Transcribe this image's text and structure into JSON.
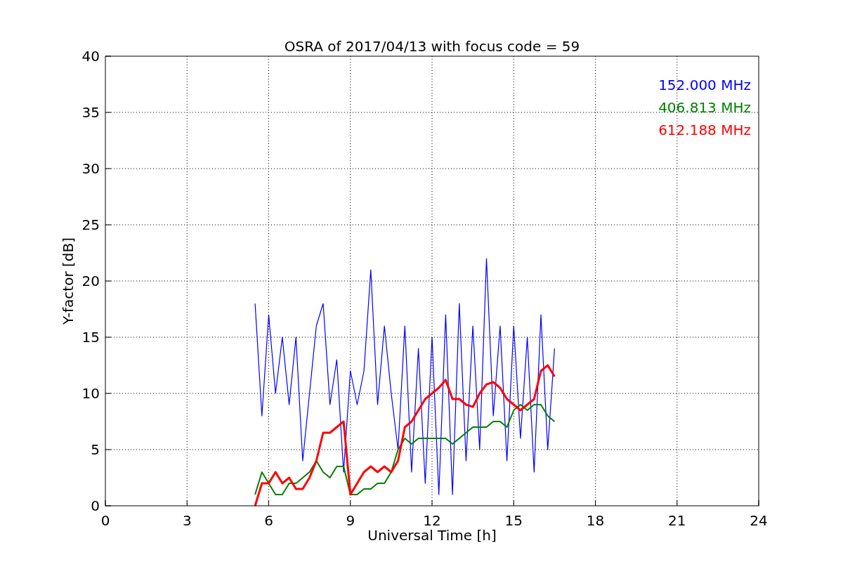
{
  "figure": {
    "chart_data": {
      "type": "line",
      "title": "OSRA of 2017/04/13 with focus code = 59",
      "xlabel": "Universal Time [h]",
      "ylabel": "Y-factor [dB]",
      "x": [
        5.5,
        5.75,
        6,
        6.25,
        6.5,
        6.75,
        7,
        7.25,
        7.5,
        7.75,
        8,
        8.25,
        8.5,
        8.75,
        9,
        9.25,
        9.5,
        9.75,
        10,
        10.25,
        10.5,
        10.75,
        11,
        11.25,
        11.5,
        11.75,
        12,
        12.25,
        12.5,
        12.75,
        13,
        13.25,
        13.5,
        13.75,
        14,
        14.25,
        14.5,
        14.75,
        15,
        15.25,
        15.5,
        15.75,
        16,
        16.25,
        16.5
      ],
      "series": [
        {
          "name": "152.000 MHz",
          "color": "#0000ff",
          "values": [
            18,
            8,
            17,
            10,
            15,
            9,
            15,
            4,
            10,
            16,
            18,
            9,
            13,
            3,
            12,
            9,
            12,
            21,
            9,
            16,
            10,
            5,
            16,
            3,
            14,
            2,
            15,
            1,
            17,
            1,
            18,
            4,
            16,
            5,
            22,
            8,
            16,
            4,
            16,
            6,
            15,
            3,
            17,
            5,
            14
          ]
        },
        {
          "name": "406.813 MHz",
          "color": "#008000",
          "values": [
            1,
            3,
            2,
            1,
            1,
            2,
            2,
            2.5,
            3,
            4,
            3,
            2.5,
            3.5,
            3.5,
            1,
            1,
            1.5,
            1.5,
            2,
            2,
            3,
            5,
            6,
            5.5,
            6,
            6,
            6,
            6,
            6,
            5.5,
            6,
            6.5,
            7,
            7,
            7,
            7.5,
            7.5,
            7,
            8.5,
            9,
            8.5,
            9,
            9,
            8,
            7.5
          ]
        },
        {
          "name": "612.188 MHz",
          "color": "#ff0000",
          "values": [
            0,
            2,
            2,
            3,
            2,
            2.5,
            1.5,
            1.5,
            2.5,
            4,
            6.5,
            6.5,
            7,
            7.5,
            1,
            2,
            3,
            3.5,
            3,
            3.5,
            3,
            4,
            7,
            7.5,
            8.5,
            9.5,
            10,
            10.5,
            11.2,
            9.5,
            9.5,
            9,
            8.8,
            10,
            10.8,
            11,
            10.5,
            9.5,
            9,
            8.5,
            9,
            9.5,
            12,
            12.5,
            11.5
          ]
        }
      ],
      "grid": true,
      "xlim": [
        0,
        24
      ],
      "ylim": [
        0,
        40
      ],
      "xticks": [
        0,
        3,
        6,
        9,
        12,
        15,
        18,
        21,
        24
      ],
      "yticks": [
        0,
        5,
        10,
        15,
        20,
        25,
        30,
        35,
        40
      ]
    }
  }
}
